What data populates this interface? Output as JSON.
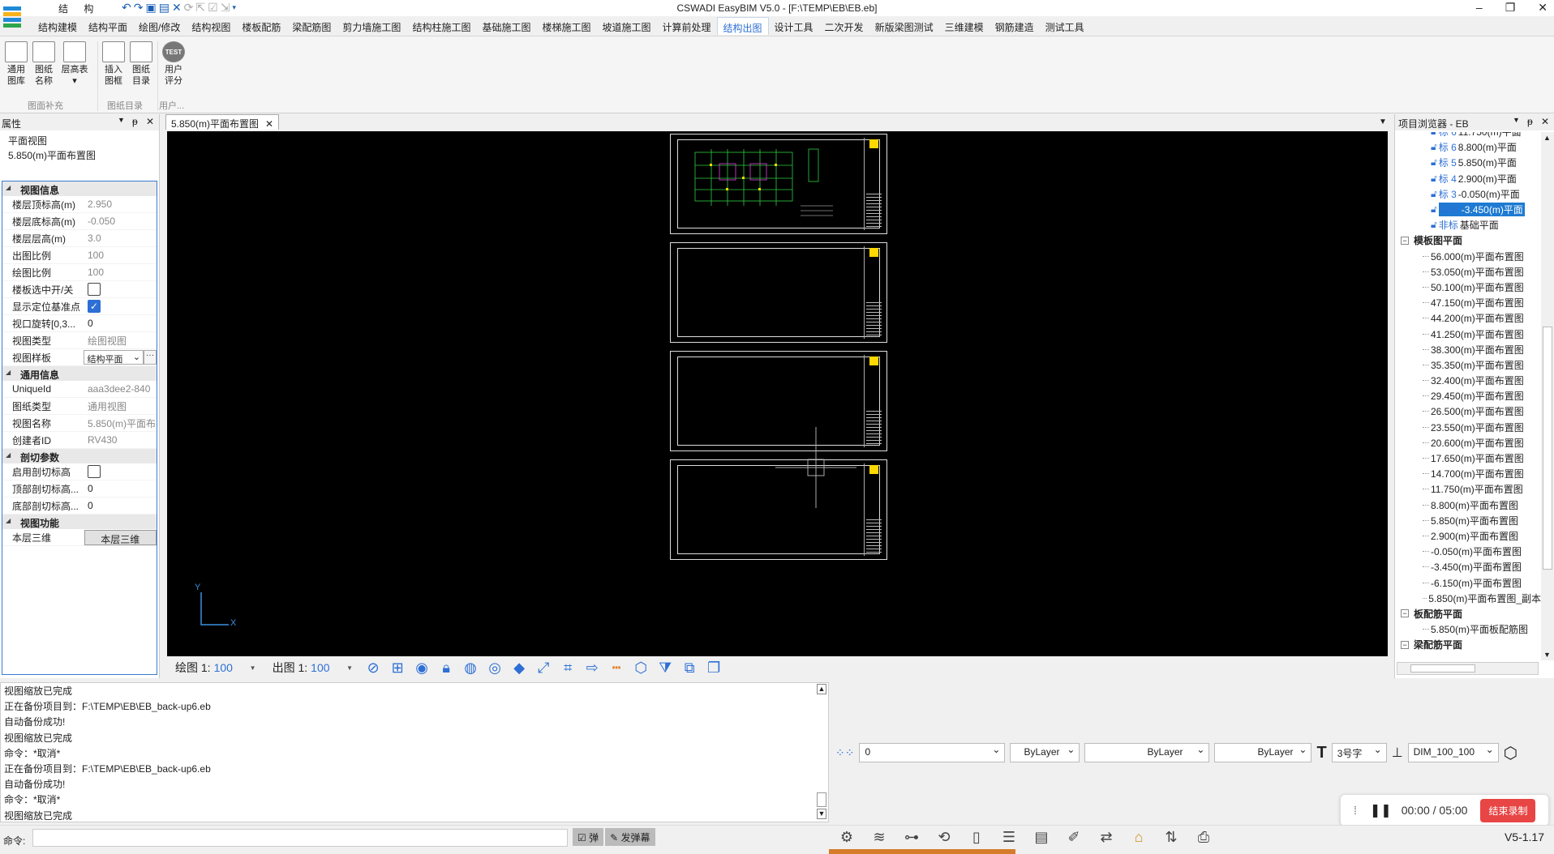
{
  "window": {
    "title": "CSWADI EasyBIM V5.0 - [F:\\TEMP\\EB\\EB.eb]",
    "quick_tab": "结 构"
  },
  "menu": [
    "结构建模",
    "结构平面",
    "绘图/修改",
    "结构视图",
    "楼板配筋",
    "梁配筋图",
    "剪力墙施工图",
    "结构柱施工图",
    "基础施工图",
    "楼梯施工图",
    "坡道施工图",
    "计算前处理",
    "结构出图",
    "设计工具",
    "二次开发",
    "新版梁图测试",
    "三维建模",
    "钢筋建造",
    "测试工具"
  ],
  "menu_active": "结构出图",
  "ribbon": {
    "buttons": [
      {
        "label1": "通用",
        "label2": "图库",
        "icon": "library-icon"
      },
      {
        "label1": "图纸",
        "label2": "名称",
        "icon": "sheet-name-icon"
      },
      {
        "label1": "层高表",
        "label2": "▾",
        "icon": "floor-height-table-icon"
      },
      {
        "label1": "插入",
        "label2": "图框",
        "icon": "insert-frame-icon"
      },
      {
        "label1": "图纸",
        "label2": "目录",
        "icon": "sheet-catalog-icon"
      },
      {
        "label1": "用户",
        "label2": "评分",
        "icon": "test-icon",
        "icon_text": "TEST"
      }
    ],
    "groups": [
      "图面补充",
      "图纸目录",
      "用户..."
    ]
  },
  "properties": {
    "title": "属性",
    "view_type_line1": "平面视图",
    "view_type_line2": "5.850(m)平面布置图",
    "sections": {
      "view_info": "视图信息",
      "general_info": "通用信息",
      "cut_params": "剖切参数",
      "view_func": "视图功能"
    },
    "rows": {
      "top_elev": {
        "k": "楼层顶标高(m)",
        "v": "2.950"
      },
      "bot_elev": {
        "k": "楼层底标高(m)",
        "v": "-0.050"
      },
      "floor_height": {
        "k": "楼层层高(m)",
        "v": "3.0"
      },
      "out_scale": {
        "k": "出图比例",
        "v": "100"
      },
      "draw_scale": {
        "k": "绘图比例",
        "v": "100"
      },
      "slab_toggle": {
        "k": "楼板选中开/关"
      },
      "show_base": {
        "k": "显示定位基准点"
      },
      "rotation": {
        "k": "视口旋转[0,3...",
        "v": "0"
      },
      "view_kind": {
        "k": "视图类型",
        "v": "绘图视图"
      },
      "view_template": {
        "k": "视图样板",
        "v": "结构平面"
      },
      "unique_id": {
        "k": "UniqueId",
        "v": "aaa3dee2-840"
      },
      "sheet_type": {
        "k": "图纸类型",
        "v": "通用视图"
      },
      "view_name": {
        "k": "视图名称",
        "v": "5.850(m)平面布"
      },
      "creator": {
        "k": "创建者ID",
        "v": "RV430"
      },
      "enable_cut": {
        "k": "启用剖切标高"
      },
      "top_cut": {
        "k": "顶部剖切标高...",
        "v": "0"
      },
      "bot_cut": {
        "k": "底部剖切标高...",
        "v": "0"
      },
      "layer3d": {
        "k": "本层三维",
        "v": "本层三维"
      }
    }
  },
  "document_tab": "5.850(m)平面布置图",
  "canvas": {
    "axis_x": "X",
    "axis_y": "Y",
    "draw_scale_label": "绘图 1:",
    "draw_scale": "100",
    "out_scale_label": "出图 1:",
    "out_scale": "100"
  },
  "browser": {
    "title": "项目浏览器 - EB",
    "levels": [
      {
        "tag": "标 6",
        "name": "11.750(m)平面"
      },
      {
        "tag": "标 6",
        "name": "8.800(m)平面"
      },
      {
        "tag": "标 5",
        "name": "5.850(m)平面"
      },
      {
        "tag": "标 4",
        "name": "2.900(m)平面"
      },
      {
        "tag": "标 3",
        "name": "-0.050(m)平面"
      },
      {
        "tag": "非标",
        "name": "-3.450(m)平面",
        "selected": true
      },
      {
        "tag": "非标",
        "name": "基础平面"
      }
    ],
    "group1": "模板图平面",
    "plans": [
      "56.000(m)平面布置图",
      "53.050(m)平面布置图",
      "50.100(m)平面布置图",
      "47.150(m)平面布置图",
      "44.200(m)平面布置图",
      "41.250(m)平面布置图",
      "38.300(m)平面布置图",
      "35.350(m)平面布置图",
      "32.400(m)平面布置图",
      "29.450(m)平面布置图",
      "26.500(m)平面布置图",
      "23.550(m)平面布置图",
      "20.600(m)平面布置图",
      "17.650(m)平面布置图",
      "14.700(m)平面布置图",
      "11.750(m)平面布置图",
      "8.800(m)平面布置图",
      "5.850(m)平面布置图",
      "2.900(m)平面布置图",
      "-0.050(m)平面布置图",
      "-3.450(m)平面布置图",
      "-6.150(m)平面布置图",
      "5.850(m)平面布置图_副本"
    ],
    "group2": "板配筋平面",
    "slab_plans": [
      "5.850(m)平面板配筋图"
    ],
    "group3": "梁配筋平面"
  },
  "log": [
    "视图缩放已完成",
    "正在备份项目到：F:\\TEMP\\EB\\EB_back-up6.eb",
    "自动备份成功!",
    "视图缩放已完成",
    "命令：*取消*",
    "正在备份项目到：F:\\TEMP\\EB\\EB_back-up6.eb",
    "自动备份成功!",
    "命令：*取消*",
    "视图缩放已完成"
  ],
  "cmd_label": "命令:",
  "danmu": {
    "check": "弹",
    "send": "发弹幕"
  },
  "toolbar2": {
    "layer": "0",
    "color": "ByLayer",
    "linetype": "ByLayer",
    "lineweight": "ByLayer",
    "text_style": "3号字",
    "dim_style": "DIM_100_100"
  },
  "recorder": {
    "time": "00:00 / 05:00",
    "stop": "结束录制"
  },
  "version": "V5-1.17"
}
